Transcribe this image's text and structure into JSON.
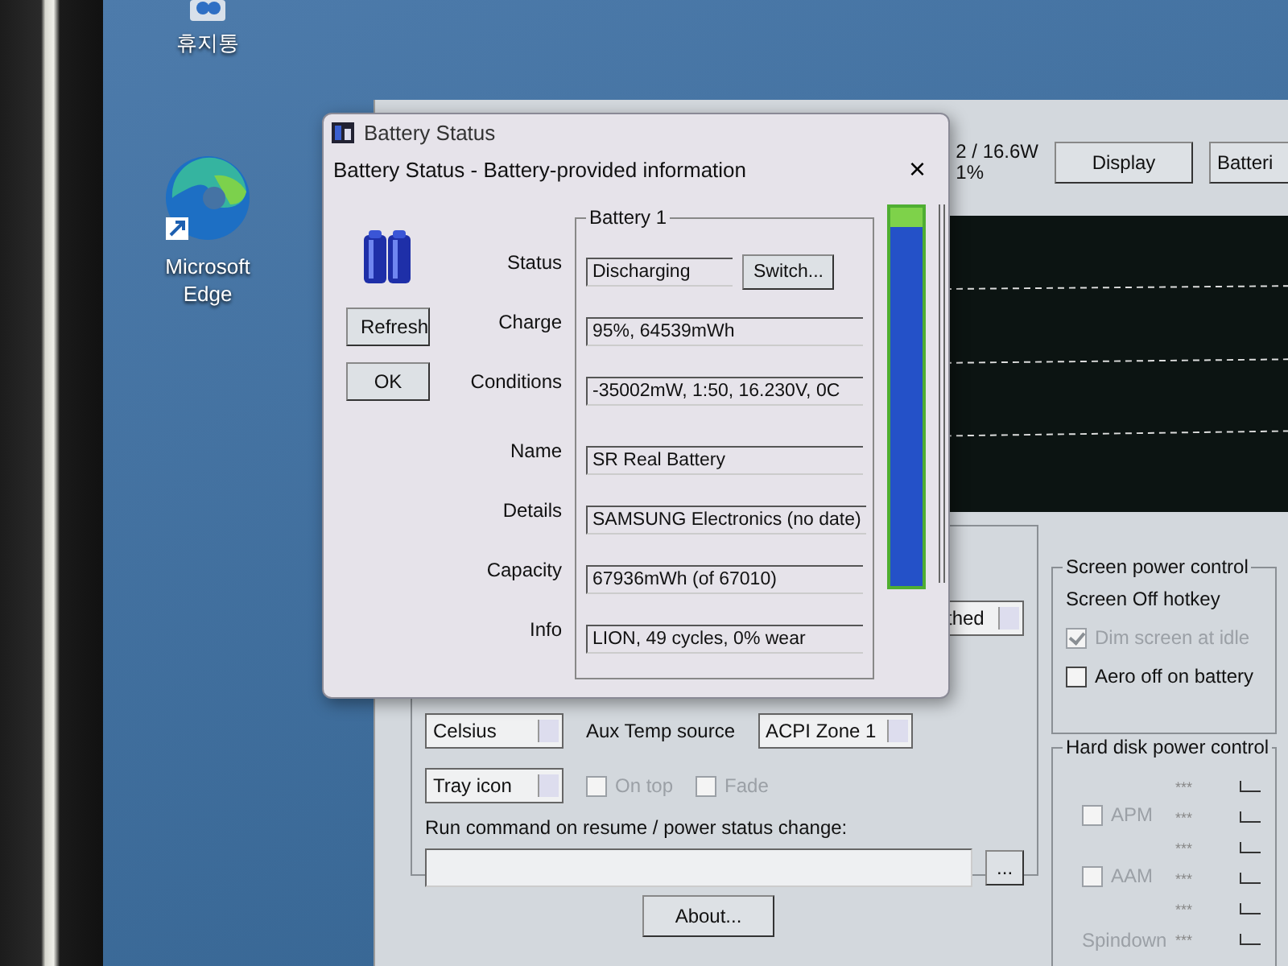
{
  "desktop": {
    "icons": [
      {
        "kind": "bin",
        "label": "휴지통"
      },
      {
        "kind": "edge",
        "label": "Microsoft Edge"
      }
    ]
  },
  "main_window": {
    "reading_1": "2 / 16.6W",
    "reading_2": "1%",
    "buttons": [
      "Display",
      "Batteri"
    ],
    "settings": {
      "dropdown_1": "thed",
      "temp_unit": "Celsius",
      "aux_temp_label": "Aux Temp source",
      "aux_temp_source": "ACPI Zone 1",
      "tray_mode": "Tray icon",
      "checkboxes": [
        {
          "label": "On top",
          "checked": false,
          "disabled": true
        },
        {
          "label": "Fade",
          "checked": false,
          "disabled": true
        }
      ],
      "run_command_label": "Run command on resume / power status change:",
      "browse_button": "..."
    },
    "about_button": "About...",
    "screen_power": {
      "title": "Screen power control",
      "hotkey_label": "Screen Off hotkey",
      "checkboxes": [
        {
          "label": "Dim screen at idle",
          "checked": true,
          "disabled": true
        },
        {
          "label": "Aero off on battery",
          "checked": false,
          "disabled": false
        }
      ]
    },
    "hard_disk": {
      "title": "Hard disk power control",
      "rows": [
        {
          "kind": "mark",
          "value": "***"
        },
        {
          "kind": "checkbox",
          "label": "APM",
          "checked": false,
          "disabled": true,
          "value": "***"
        },
        {
          "kind": "mark",
          "value": "***"
        },
        {
          "kind": "checkbox",
          "label": "AAM",
          "checked": false,
          "disabled": true,
          "value": "***"
        },
        {
          "kind": "mark",
          "value": "***"
        },
        {
          "kind": "label",
          "label": "Spindown",
          "value": "***"
        }
      ]
    }
  },
  "dialog": {
    "title": "Battery Status",
    "heading": "Battery Status - Battery-provided information",
    "close": "×",
    "buttons": [
      "Refresh",
      "OK"
    ],
    "group_title": "Battery 1",
    "switch_button": "Switch...",
    "fields": [
      {
        "label": "Status",
        "value": "Discharging"
      },
      {
        "label": "Charge",
        "value": "95%, 64539mWh"
      },
      {
        "label": "Conditions",
        "value": "-35002mW, 1:50, 16.230V, 0C"
      },
      {
        "label": "Name",
        "value": "SR Real Battery"
      },
      {
        "label": "Details",
        "value": "SAMSUNG Electronics (no date)"
      },
      {
        "label": "Capacity",
        "value": "67936mWh (of 67010)"
      },
      {
        "label": "Info",
        "value": "LION, 49 cycles, 0% wear"
      }
    ],
    "charge": {
      "level": 0.95
    }
  }
}
